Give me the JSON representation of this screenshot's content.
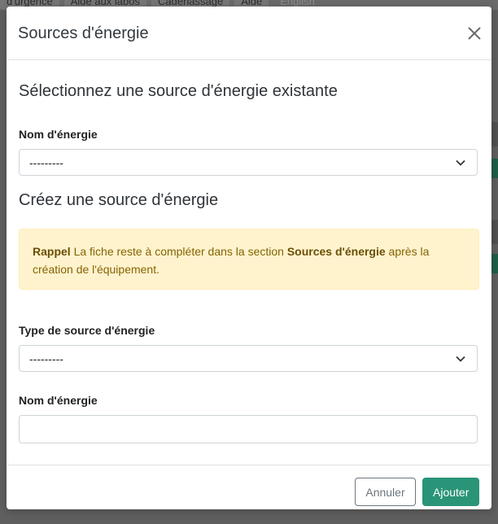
{
  "background": {
    "tabs": [
      "d'urgence",
      "Aide aux labos",
      "Cadenassage",
      "Aide",
      "English"
    ]
  },
  "modal": {
    "title": "Sources d'énergie",
    "existing_section": {
      "heading": "Sélectionnez une source d'énergie existante",
      "energy_name_label": "Nom d'énergie",
      "energy_name_selected": "---------"
    },
    "create_section": {
      "heading": "Créez une source d'énergie",
      "alert": {
        "strong_label": "Rappel",
        "text_before": " La fiche reste à compléter dans la section ",
        "strong_section": "Sources d'énergie",
        "text_after": " après la création de l'équipement."
      },
      "source_type_label": "Type de source d'énergie",
      "source_type_selected": "---------",
      "energy_name_label": "Nom d'énergie",
      "energy_name_value": ""
    },
    "footer": {
      "cancel_label": "Annuler",
      "add_label": "Ajouter"
    }
  },
  "colors": {
    "primary_button": "#2a9478",
    "alert_background": "#fff3cd",
    "alert_text": "#856404",
    "overlay": "#5f5f5f"
  },
  "icons": {
    "close": "close-icon",
    "dropdown": "chevron-down-icon"
  }
}
